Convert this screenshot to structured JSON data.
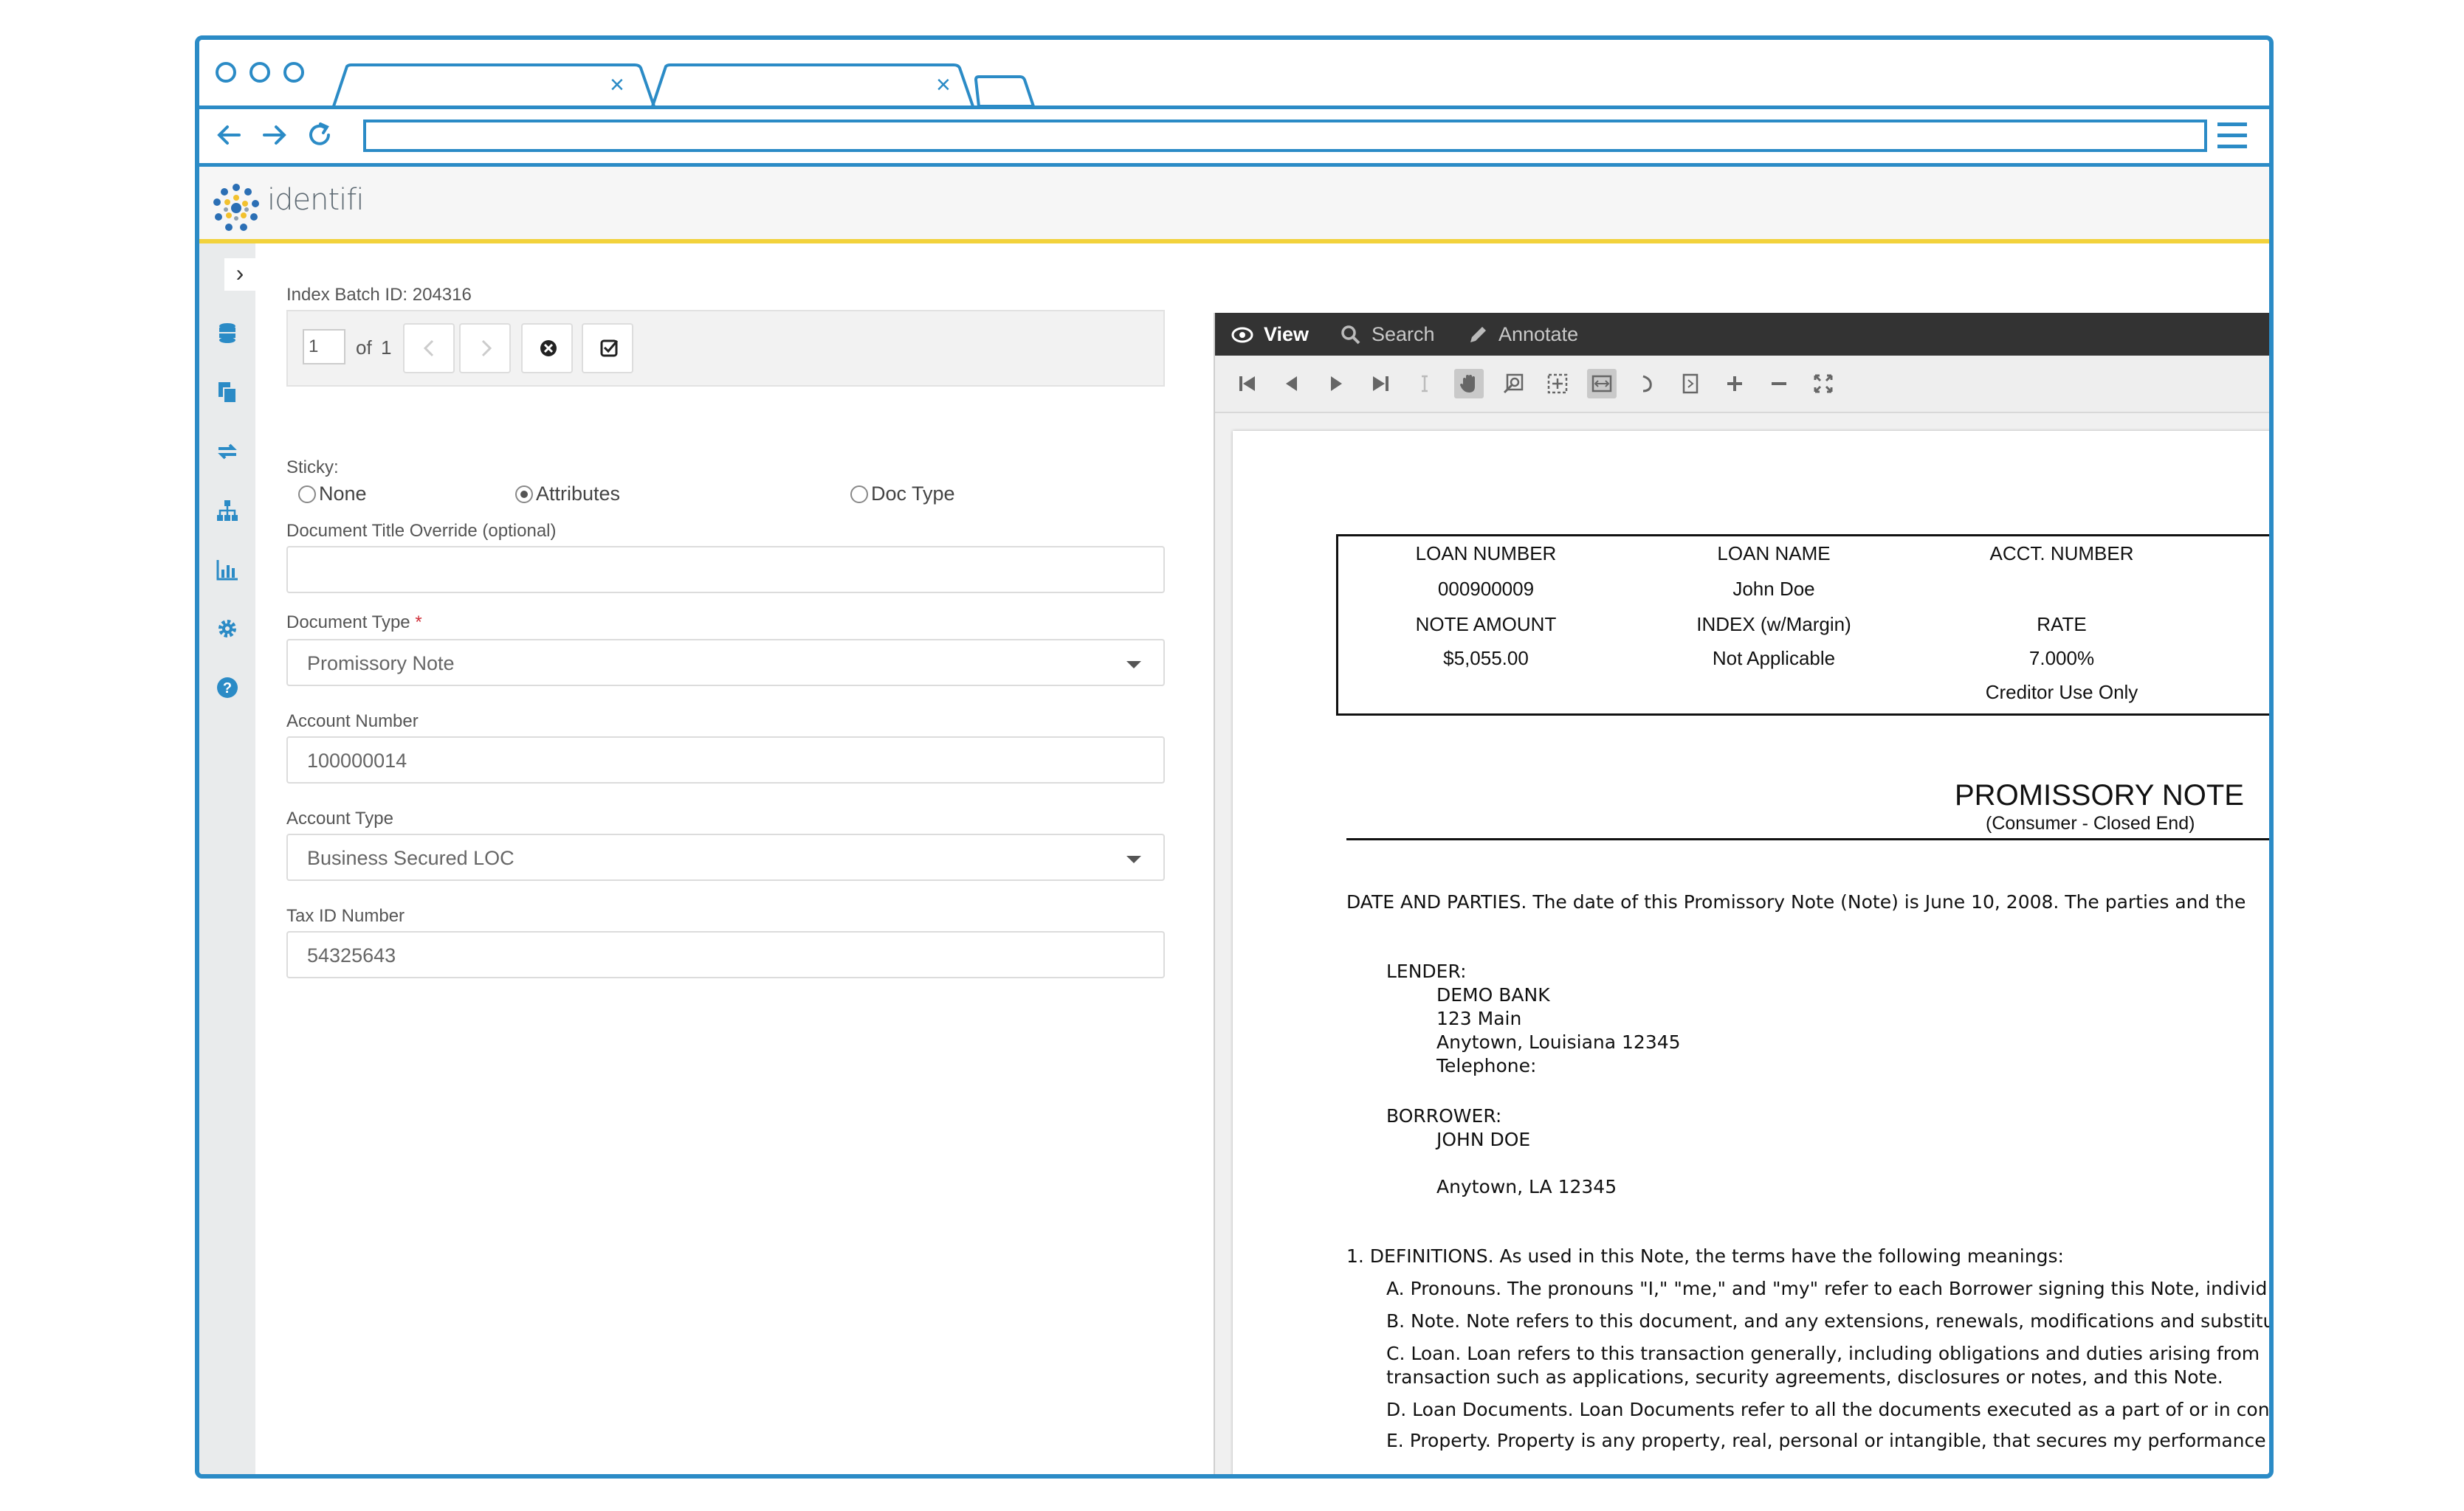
{
  "browser": {
    "tabs": [
      {
        "label": ""
      },
      {
        "label": ""
      }
    ],
    "tab_close_glyph": "×",
    "url": "",
    "nav_icons": [
      "back-arrow-icon",
      "forward-arrow-icon",
      "reload-icon"
    ],
    "menu_icon": "hamburger-menu-icon"
  },
  "app": {
    "logo_text": "identifi",
    "accent_color": "#2b8bc6",
    "header_stripe_color": "#f2d23c"
  },
  "rail": {
    "toggle_glyph": "›",
    "icons": [
      "database-icon",
      "documents-icon",
      "transfer-icon",
      "org-chart-icon",
      "bar-chart-icon",
      "gear-icon",
      "help-icon"
    ]
  },
  "form": {
    "batch_label": "Index Batch ID: 204316",
    "pager": {
      "page_value": "1",
      "of_label": "of",
      "total": "1"
    },
    "sticky": {
      "label": "Sticky:",
      "options": [
        {
          "label": "None",
          "selected": false
        },
        {
          "label": "Attributes",
          "selected": true
        },
        {
          "label": "Doc Type",
          "selected": false
        }
      ]
    },
    "title_override": {
      "label": "Document Title Override (optional)",
      "value": ""
    },
    "doc_type": {
      "label": "Document Type",
      "required_mark": "*",
      "value": "Promissory Note"
    },
    "account_number": {
      "label": "Account Number",
      "value": "100000014"
    },
    "account_type": {
      "label": "Account Type",
      "value": "Business Secured LOC"
    },
    "tax_id": {
      "label": "Tax ID Number",
      "value": "54325643"
    }
  },
  "viewer": {
    "tabs": [
      {
        "label": "View",
        "icon": "eye-icon",
        "active": true
      },
      {
        "label": "Search",
        "icon": "search-icon",
        "active": false
      },
      {
        "label": "Annotate",
        "icon": "pencil-icon",
        "active": false
      }
    ]
  },
  "document": {
    "table": {
      "h1": "LOAN NUMBER",
      "h2": "LOAN NAME",
      "h3": "ACCT. NUMBER",
      "v1": "000900009",
      "v2": "John  Doe",
      "h4": "NOTE AMOUNT",
      "h5": "INDEX (w/Margin)",
      "h6": "RATE",
      "v4": "$5,055.00",
      "v5": "Not Applicable",
      "v6": "7.000%",
      "footer": "Creditor Use Only"
    },
    "title": "PROMISSORY NOTE",
    "subtitle": "(Consumer - Closed End)",
    "parties_line": "DATE AND PARTIES.  The date of this Promissory Note (Note) is June 10, 2008.  The parties and the",
    "lender_label": "LENDER:",
    "lender_lines": [
      "DEMO BANK",
      "123 Main",
      "Anytown, Louisiana  12345",
      "Telephone:"
    ],
    "borrower_label": "BORROWER:",
    "borrower_lines": [
      "JOHN  DOE",
      "Anytown, LA 12345"
    ],
    "definitions_heading": "1. DEFINITIONS.  As used in this Note, the terms have the following meanings:",
    "definitions": [
      "A. Pronouns.  The pronouns \"I,\" \"me,\" and \"my\" refer to each Borrower signing this Note, individ",
      "B. Note.  Note refers to this document, and any extensions, renewals, modifications and substitu",
      "C. Loan.  Loan refers to this transaction generally, including obligations and duties arising from",
      "transaction such as applications, security agreements, disclosures or notes, and this Note.",
      "D. Loan Documents.  Loan Documents refer to all the documents executed as a part of or in conn",
      "E. Property.  Property is any property, real, personal or intangible, that secures my performance c"
    ]
  }
}
